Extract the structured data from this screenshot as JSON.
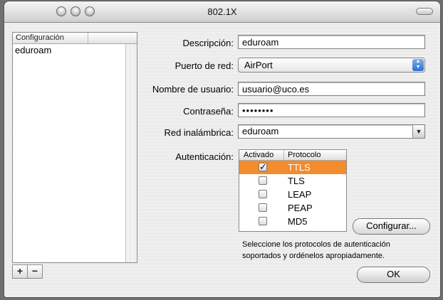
{
  "window": {
    "title": "802.1X"
  },
  "sidebar": {
    "column_header": "Configuración",
    "items": [
      "eduroam"
    ],
    "add_label": "+",
    "remove_label": "−"
  },
  "form": {
    "description_label": "Descripción:",
    "description_value": "eduroam",
    "port_label": "Puerto de red:",
    "port_value": "AirPort",
    "username_label": "Nombre de usuario:",
    "username_value": "usuario@uco.es",
    "password_label": "Contraseña:",
    "password_value": "••••••••",
    "wireless_label": "Red inalámbrica:",
    "wireless_value": "eduroam",
    "auth_label": "Autenticación:"
  },
  "auth_table": {
    "col_enabled": "Activado",
    "col_protocol": "Protocolo",
    "rows": [
      {
        "protocol": "TTLS",
        "enabled": true,
        "selected": true
      },
      {
        "protocol": "TLS",
        "enabled": false,
        "selected": false
      },
      {
        "protocol": "LEAP",
        "enabled": false,
        "selected": false
      },
      {
        "protocol": "PEAP",
        "enabled": false,
        "selected": false
      },
      {
        "protocol": "MD5",
        "enabled": false,
        "selected": false
      }
    ]
  },
  "buttons": {
    "configure": "Configurar...",
    "ok": "OK"
  },
  "hint": "Seleccione los protocolos de autenticación soportados y ordénelos apropiadamente.",
  "colors": {
    "selection": "#f28c2c"
  }
}
